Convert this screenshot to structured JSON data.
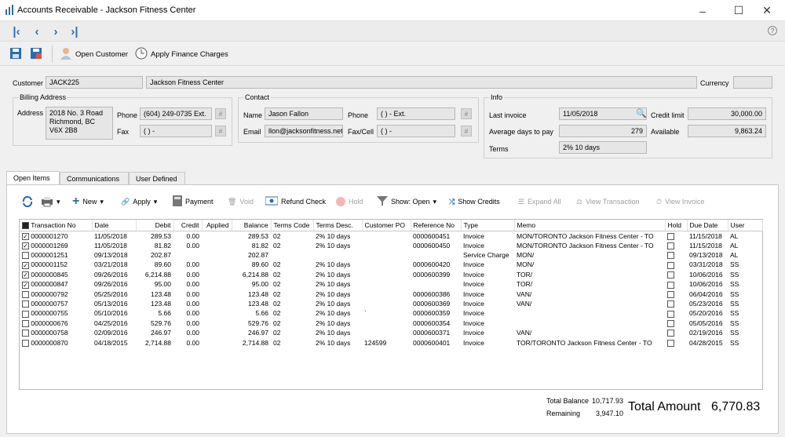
{
  "window": {
    "title": "Accounts Receivable - Jackson Fitness Center"
  },
  "toolbar": {
    "open_customer": "Open Customer",
    "apply_finance": "Apply Finance Charges"
  },
  "customer": {
    "label": "Customer",
    "code": "JACK225",
    "name": "Jackson Fitness Center",
    "currency_label": "Currency",
    "currency": ""
  },
  "billing": {
    "title": "Billing Address",
    "address_label": "Address",
    "address_lines": [
      "2018 No. 3 Road",
      "Richmond, BC",
      "V6X 2B8"
    ],
    "phone_label": "Phone",
    "phone": "(604) 249-0735 Ext.",
    "fax_label": "Fax",
    "fax": "(   )   -"
  },
  "contact": {
    "title": "Contact",
    "name_label": "Name",
    "name": "Jason Fallon",
    "email_label": "Email",
    "email": "llon@jacksonfitness.net",
    "phone_label": "Phone",
    "phone": "(   )   -      Ext.",
    "fax_label": "Fax/Cell",
    "fax": "(   )   -"
  },
  "info": {
    "title": "Info",
    "last_invoice_label": "Last invoice",
    "last_invoice": "11/05/2018",
    "avg_days_label": "Average days to pay",
    "avg_days": "279",
    "terms_label": "Terms",
    "terms": "2% 10 days",
    "credit_limit_label": "Credit limit",
    "credit_limit": "30,000.00",
    "available_label": "Available",
    "available": "9,863.24"
  },
  "tabs": [
    "Open Items",
    "Communications",
    "User Defined"
  ],
  "actions": {
    "new": "New",
    "apply": "Apply",
    "payment": "Payment",
    "void": "Void",
    "refund_check": "Refund Check",
    "hold": "Hold",
    "show": "Show: Open",
    "show_credits": "Show Credits",
    "expand_all": "Expand All",
    "view_transaction": "View Transaction",
    "view_invoice": "View Invoice"
  },
  "table": {
    "columns": [
      "Transaction No",
      "Date",
      "Debit",
      "Credit",
      "Applied",
      "Balance",
      "Terms Code",
      "Terms Desc.",
      "Customer PO",
      "Reference No",
      "Type",
      "Memo",
      "Hold",
      "Due Date",
      "User"
    ],
    "rows": [
      {
        "checked": true,
        "txn": "0000001270",
        "date": "11/05/2018",
        "debit": "289.53",
        "credit": "0.00",
        "applied": "",
        "balance": "289.53",
        "terms_code": "02",
        "terms_desc": "2% 10 days",
        "po": "",
        "ref": "0000600451",
        "type": "Invoice",
        "memo": "MON/TORONTO Jackson Fitness Center  - TO",
        "due": "11/15/2018",
        "user": "AL"
      },
      {
        "checked": true,
        "txn": "0000001269",
        "date": "11/05/2018",
        "debit": "81.82",
        "credit": "0.00",
        "applied": "",
        "balance": "81.82",
        "terms_code": "02",
        "terms_desc": "2% 10 days",
        "po": "",
        "ref": "0000600450",
        "type": "Invoice",
        "memo": "MON/TORONTO Jackson Fitness Center  - TO",
        "due": "11/15/2018",
        "user": "AL"
      },
      {
        "checked": false,
        "txn": "0000001251",
        "date": "09/13/2018",
        "debit": "202.87",
        "credit": "",
        "applied": "",
        "balance": "202.87",
        "terms_code": "",
        "terms_desc": "",
        "po": "",
        "ref": "",
        "type": "Service Charge",
        "memo": "MON/",
        "due": "09/13/2018",
        "user": "AL"
      },
      {
        "checked": true,
        "txn": "0000001152",
        "date": "03/21/2018",
        "debit": "89.60",
        "credit": "0.00",
        "applied": "",
        "balance": "89.60",
        "terms_code": "02",
        "terms_desc": "2% 10 days",
        "po": "",
        "ref": "0000600420",
        "type": "Invoice",
        "memo": "MON/",
        "due": "03/31/2018",
        "user": "SS"
      },
      {
        "checked": true,
        "txn": "0000000845",
        "date": "09/26/2016",
        "debit": "6,214.88",
        "credit": "0.00",
        "applied": "",
        "balance": "6,214.88",
        "terms_code": "02",
        "terms_desc": "2% 10 days",
        "po": "",
        "ref": "0000600399",
        "type": "Invoice",
        "memo": "TOR/",
        "due": "10/06/2016",
        "user": "SS"
      },
      {
        "checked": true,
        "txn": "0000000847",
        "date": "09/26/2016",
        "debit": "95.00",
        "credit": "0.00",
        "applied": "",
        "balance": "95.00",
        "terms_code": "02",
        "terms_desc": "2% 10 days",
        "po": "",
        "ref": "",
        "type": "Invoice",
        "memo": "TOR/",
        "due": "10/06/2016",
        "user": "SS"
      },
      {
        "checked": false,
        "txn": "0000000792",
        "date": "05/25/2016",
        "debit": "123.48",
        "credit": "0.00",
        "applied": "",
        "balance": "123.48",
        "terms_code": "02",
        "terms_desc": "2% 10 days",
        "po": "",
        "ref": "0000600386",
        "type": "Invoice",
        "memo": "VAN/",
        "due": "06/04/2016",
        "user": "SS"
      },
      {
        "checked": false,
        "txn": "0000000757",
        "date": "05/13/2016",
        "debit": "123.48",
        "credit": "0.00",
        "applied": "",
        "balance": "123.48",
        "terms_code": "02",
        "terms_desc": "2% 10 days",
        "po": "",
        "ref": "0000600369",
        "type": "Invoice",
        "memo": "VAN/",
        "due": "05/23/2016",
        "user": "SS"
      },
      {
        "checked": false,
        "txn": "0000000755",
        "date": "05/10/2016",
        "debit": "5.66",
        "credit": "0.00",
        "applied": "",
        "balance": "5.66",
        "terms_code": "02",
        "terms_desc": "2% 10 days",
        "po": "`",
        "ref": "0000600359",
        "type": "Invoice",
        "memo": "",
        "due": "05/20/2016",
        "user": "SS"
      },
      {
        "checked": false,
        "txn": "0000000676",
        "date": "04/25/2016",
        "debit": "529.76",
        "credit": "0.00",
        "applied": "",
        "balance": "529.76",
        "terms_code": "02",
        "terms_desc": "2% 10 days",
        "po": "",
        "ref": "0000600354",
        "type": "Invoice",
        "memo": "",
        "due": "05/05/2016",
        "user": "SS"
      },
      {
        "checked": false,
        "txn": "0000000758",
        "date": "02/09/2016",
        "debit": "246.97",
        "credit": "0.00",
        "applied": "",
        "balance": "246.97",
        "terms_code": "02",
        "terms_desc": "2% 10 days",
        "po": "",
        "ref": "0000600371",
        "type": "Invoice",
        "memo": "VAN/",
        "due": "02/19/2016",
        "user": "SS"
      },
      {
        "checked": false,
        "txn": "0000000870",
        "date": "04/18/2015",
        "debit": "2,714.88",
        "credit": "0.00",
        "applied": "",
        "balance": "2,714.88",
        "terms_code": "02",
        "terms_desc": "2% 10 days",
        "po": "124599",
        "ref": "0000600401",
        "type": "Invoice",
        "memo": "TOR/TORONTO Jackson Fitness Center  - TO",
        "due": "04/28/2015",
        "user": "SS"
      }
    ]
  },
  "totals": {
    "total_balance_label": "Total Balance",
    "total_balance": "10,717.93",
    "remaining_label": "Remaining",
    "remaining": "3,947.10",
    "total_amount_label": "Total Amount",
    "total_amount": "6,770.83"
  },
  "colors": {
    "accent": "#2b6cb0",
    "checkbox_check": "#000000"
  }
}
